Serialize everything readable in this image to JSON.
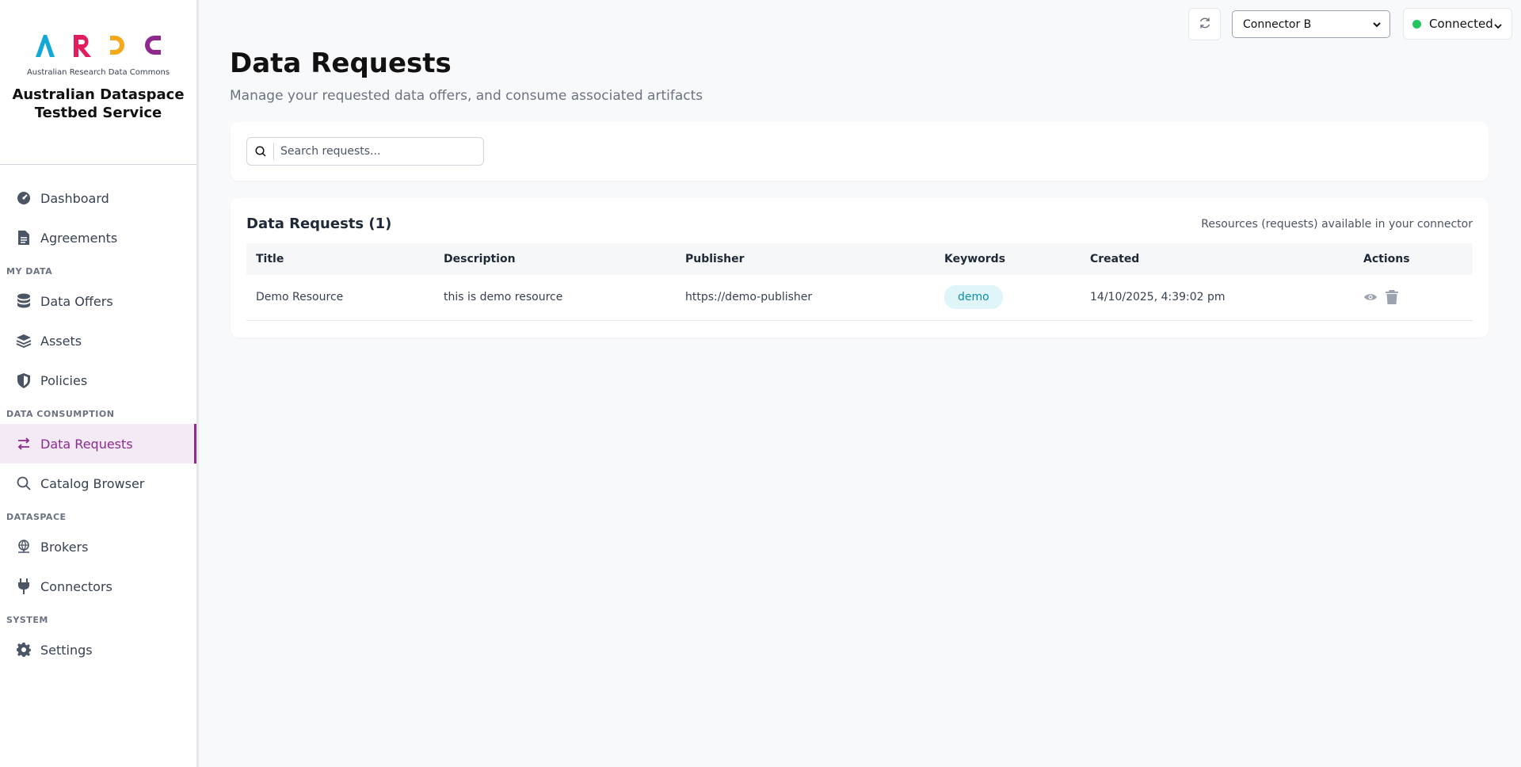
{
  "brand": {
    "logo_letters": [
      "A",
      "R",
      "D",
      "C"
    ],
    "logo_subtitle": "Australian Research Data Commons",
    "title_line1": "Australian Dataspace",
    "title_line2": "Testbed Service",
    "colors": {
      "a": "#13a8d6",
      "r": "#e21d5f",
      "d": "#f6a81b",
      "c": "#8e2a8e"
    }
  },
  "sidebar": {
    "items": [
      {
        "label": "Dashboard",
        "icon": "dashboard-icon"
      },
      {
        "label": "Agreements",
        "icon": "document-icon"
      }
    ],
    "sections": [
      {
        "title": "MY DATA",
        "items": [
          {
            "label": "Data Offers",
            "icon": "database-icon"
          },
          {
            "label": "Assets",
            "icon": "layers-icon"
          },
          {
            "label": "Policies",
            "icon": "shield-icon"
          }
        ]
      },
      {
        "title": "DATA CONSUMPTION",
        "items": [
          {
            "label": "Data Requests",
            "icon": "exchange-icon",
            "active": true
          },
          {
            "label": "Catalog Browser",
            "icon": "search-icon"
          }
        ]
      },
      {
        "title": "DATASPACE",
        "items": [
          {
            "label": "Brokers",
            "icon": "network-icon"
          },
          {
            "label": "Connectors",
            "icon": "plug-icon"
          }
        ]
      },
      {
        "title": "SYSTEM",
        "items": [
          {
            "label": "Settings",
            "icon": "gear-icon"
          }
        ]
      }
    ],
    "accent_color": "#8e2a8e"
  },
  "topbar": {
    "connector_value": "Connector B",
    "status_label": "Connected",
    "status_color": "#22c55e"
  },
  "page": {
    "title": "Data Requests",
    "subtitle": "Manage your requested data offers, and consume associated artifacts"
  },
  "search": {
    "placeholder": "Search requests..."
  },
  "table": {
    "title": "Data Requests (1)",
    "note": "Resources (requests) available in your connector",
    "columns": [
      "Title",
      "Description",
      "Publisher",
      "Keywords",
      "Created",
      "Actions"
    ],
    "rows": [
      {
        "title": "Demo Resource",
        "description": "this is demo resource",
        "publisher": "https://demo-publisher",
        "keyword": "demo",
        "created": "14/10/2025, 4:39:02 pm"
      }
    ]
  }
}
